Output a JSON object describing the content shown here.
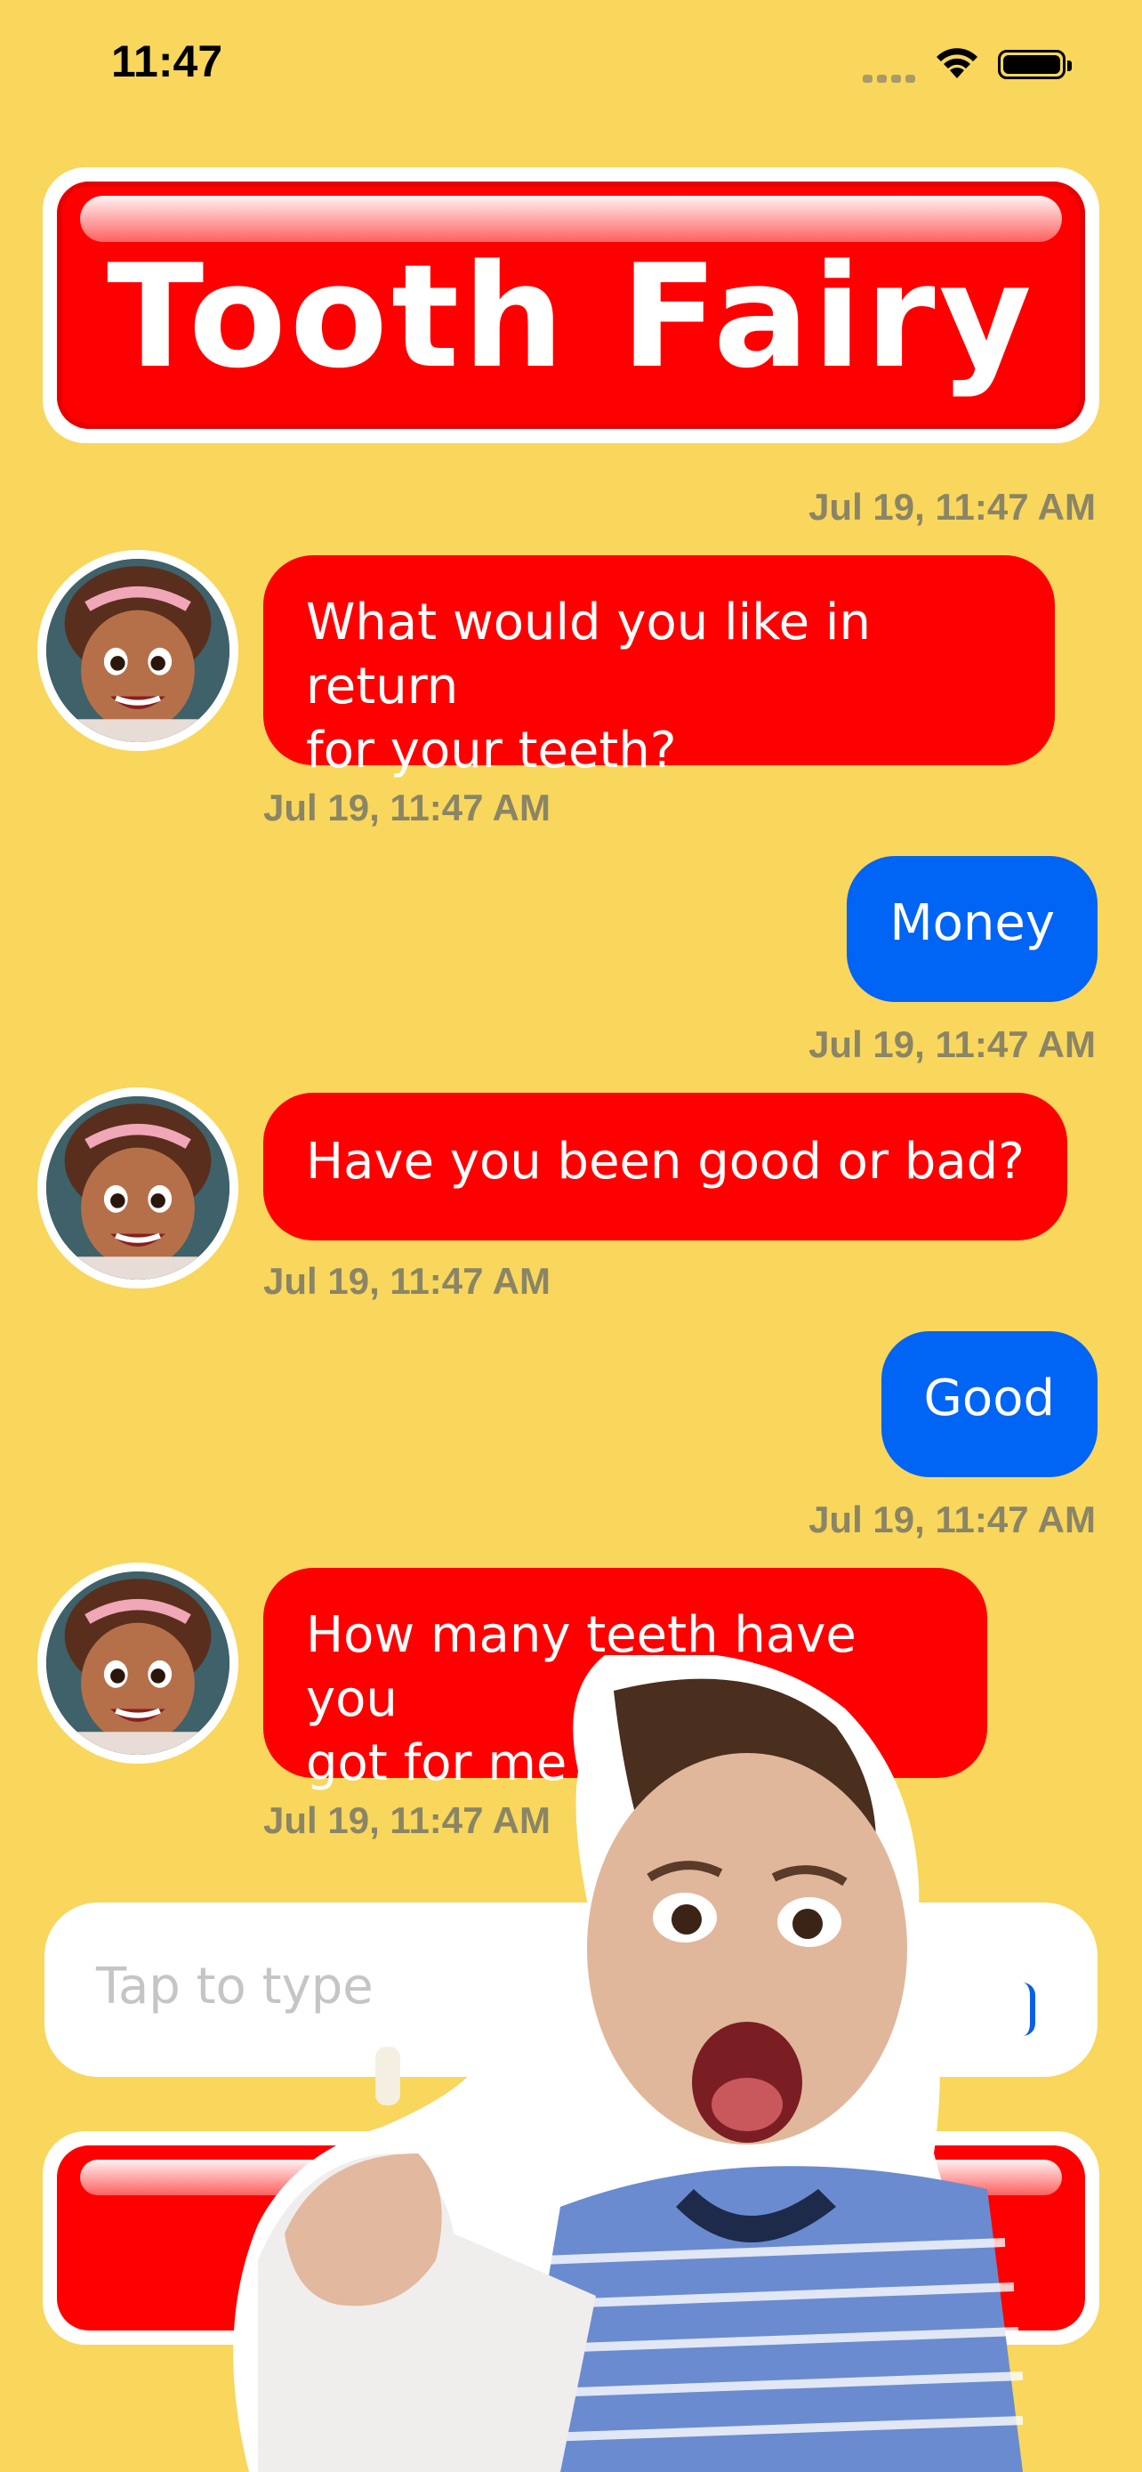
{
  "status_bar": {
    "time": "11:47"
  },
  "header": {
    "title": "Tooth Fairy"
  },
  "messages": [
    {
      "sender": "fairy",
      "timestamp_above": "Jul 19, 11:47 AM",
      "text": "What would you like in return\nfor your teeth?",
      "timestamp_below": "Jul 19, 11:47 AM"
    },
    {
      "sender": "user",
      "text": "Money",
      "timestamp_below": "Jul 19, 11:47 AM"
    },
    {
      "sender": "fairy",
      "text": "Have you been good or bad?",
      "timestamp_below": "Jul 19, 11:47 AM"
    },
    {
      "sender": "user",
      "text": "Good",
      "timestamp_below": "Jul 19, 11:47 AM"
    },
    {
      "sender": "fairy",
      "text": "How many teeth have you\ngot for me to coll",
      "timestamp_below": "Jul 19, 11:47 AM"
    }
  ],
  "composer": {
    "placeholder": "Tap to type"
  },
  "colors": {
    "background": "#F9D65C",
    "fairy_bubble": "#FF0000",
    "user_bubble": "#0064F5",
    "timestamp": "#8A8566"
  },
  "icons": {
    "wifi": "wifi-icon",
    "battery": "battery-icon",
    "signal": "cellular-signal-icon",
    "send": "send-icon"
  }
}
